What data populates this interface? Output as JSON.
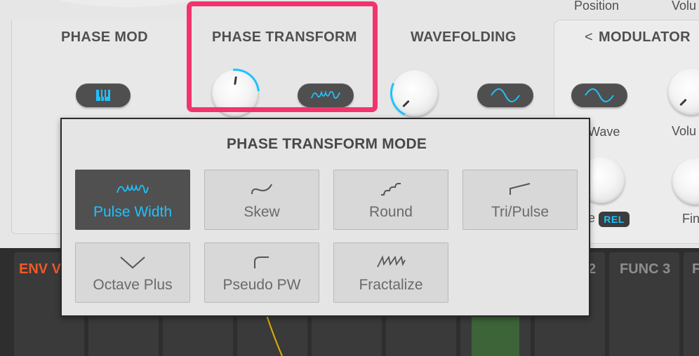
{
  "top_labels": {
    "position": "Position",
    "volume_partial": "Volu"
  },
  "sections": {
    "phase_mod": "PHASE MOD",
    "phase_transform": "PHASE TRANSFORM",
    "wavefolding": "WAVEFOLDING",
    "modulator": "MODULATOR",
    "modulator_back_glyph": "<"
  },
  "modulator_labels": {
    "wave": "Wave",
    "volume": "Volu",
    "fine": "Fin",
    "rel_prefix": "e",
    "rel_badge": "REL"
  },
  "popup": {
    "title": "PHASE TRANSFORM MODE",
    "options": [
      {
        "label": "Pulse Width",
        "icon": "pulse-width-wave-icon",
        "selected": true
      },
      {
        "label": "Skew",
        "icon": "skew-curve-icon",
        "selected": false
      },
      {
        "label": "Round",
        "icon": "round-steps-icon",
        "selected": false
      },
      {
        "label": "Tri/Pulse",
        "icon": "tri-pulse-icon",
        "selected": false
      },
      {
        "label": "Octave Plus",
        "icon": "octave-plus-icon",
        "selected": false
      },
      {
        "label": "Pseudo PW",
        "icon": "pseudo-pw-icon",
        "selected": false
      },
      {
        "label": "Fractalize",
        "icon": "fractalize-icon",
        "selected": false
      }
    ]
  },
  "bottom_tabs": {
    "env": "ENV V",
    "func2": "2",
    "func3": "FUNC 3",
    "next": "F"
  },
  "colors": {
    "accent": "#1ec2ff",
    "highlight": "#f2346c",
    "env": "#f05a28"
  }
}
